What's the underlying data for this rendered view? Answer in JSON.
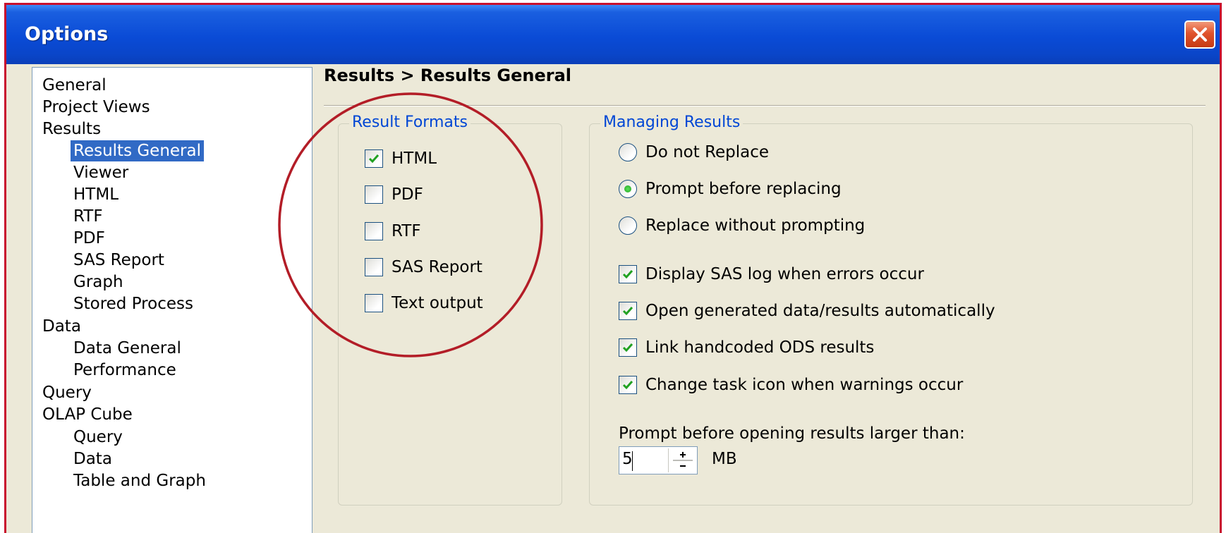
{
  "window": {
    "title": "Options",
    "close_icon": "close-x-icon",
    "colors": {
      "titlebar": "#0a4bd6",
      "close": "#e0532c",
      "frame": "#c8102e",
      "selection": "#316ac5"
    }
  },
  "tree": {
    "items": [
      {
        "label": "General",
        "level": 0,
        "selected": false
      },
      {
        "label": "Project Views",
        "level": 0,
        "selected": false
      },
      {
        "label": "Results",
        "level": 0,
        "selected": false
      },
      {
        "label": "Results General",
        "level": 1,
        "selected": true
      },
      {
        "label": "Viewer",
        "level": 1,
        "selected": false
      },
      {
        "label": "HTML",
        "level": 1,
        "selected": false
      },
      {
        "label": "RTF",
        "level": 1,
        "selected": false
      },
      {
        "label": "PDF",
        "level": 1,
        "selected": false
      },
      {
        "label": "SAS Report",
        "level": 1,
        "selected": false
      },
      {
        "label": "Graph",
        "level": 1,
        "selected": false
      },
      {
        "label": "Stored Process",
        "level": 1,
        "selected": false
      },
      {
        "label": "Data",
        "level": 0,
        "selected": false
      },
      {
        "label": "Data General",
        "level": 1,
        "selected": false
      },
      {
        "label": "Performance",
        "level": 1,
        "selected": false
      },
      {
        "label": "Query",
        "level": 0,
        "selected": false
      },
      {
        "label": "OLAP Cube",
        "level": 0,
        "selected": false
      },
      {
        "label": "Query",
        "level": 1,
        "selected": false
      },
      {
        "label": "Data",
        "level": 1,
        "selected": false
      },
      {
        "label": "Table and Graph",
        "level": 1,
        "selected": false
      }
    ]
  },
  "panel": {
    "heading": "Results > Results General"
  },
  "result_formats": {
    "legend": "Result Formats",
    "options": [
      {
        "label": "HTML",
        "checked": true
      },
      {
        "label": "PDF",
        "checked": false
      },
      {
        "label": "RTF",
        "checked": false
      },
      {
        "label": "SAS Report",
        "checked": false
      },
      {
        "label": "Text output",
        "checked": false
      }
    ]
  },
  "managing_results": {
    "legend": "Managing Results",
    "radios": [
      {
        "label": "Do not Replace",
        "selected": false
      },
      {
        "label": "Prompt before replacing",
        "selected": true
      },
      {
        "label": "Replace without prompting",
        "selected": false
      }
    ],
    "checkboxes": [
      {
        "label": "Display SAS log when errors occur",
        "checked": true
      },
      {
        "label": "Open generated data/results automatically",
        "checked": true
      },
      {
        "label": "Link handcoded ODS results",
        "checked": true
      },
      {
        "label": "Change task icon when warnings occur",
        "checked": true
      }
    ],
    "size_prompt": {
      "label": "Prompt before opening results larger than:",
      "value": "5",
      "unit": "MB"
    }
  }
}
